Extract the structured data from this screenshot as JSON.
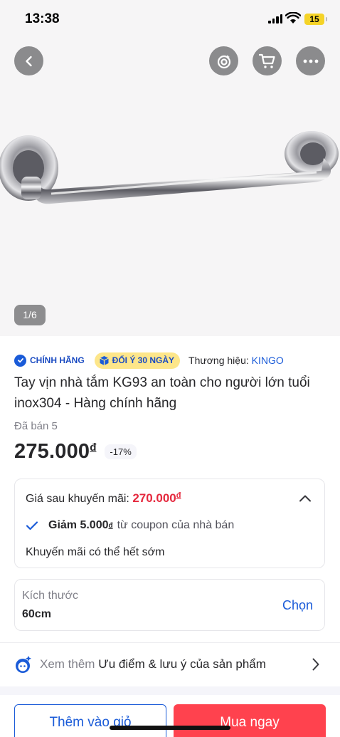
{
  "status_bar": {
    "time": "13:38",
    "battery": "15"
  },
  "gallery": {
    "counter": "1/6"
  },
  "product": {
    "badges": {
      "authentic": "CHÍNH HÃNG",
      "return_policy": "ĐỔI Ý 30 NGÀY"
    },
    "brand_label": "Thương hiệu:",
    "brand_name": "KINGO",
    "title": "Tay vịn nhà tắm KG93 an toàn cho người lớn tuổi inox304 - Hàng chính hãng",
    "sold": "Đã bán 5",
    "price": "275.000",
    "currency": "đ",
    "discount": "-17%"
  },
  "promo": {
    "label": "Giá sau khuyến mãi:",
    "price": "270.000",
    "currency": "đ",
    "coupon_strong": "Giảm 5.000",
    "coupon_currency": "đ",
    "coupon_rest": "từ coupon của nhà bán",
    "note": "Khuyến mãi có thể hết sớm"
  },
  "size": {
    "label": "Kích thước",
    "value": "60cm",
    "choose": "Chọn"
  },
  "see_more": {
    "prefix": "Xem thêm",
    "strong": "Ưu điểm & lưu ý của sản phẩm"
  },
  "actions": {
    "add_to_cart": "Thêm vào giỏ",
    "buy_now": "Mua ngay"
  },
  "colors": {
    "accent_blue": "#1a5bd8",
    "buy_red": "#ff424e",
    "promo_red": "#e5293e",
    "badge_yellow": "#fde68a"
  }
}
